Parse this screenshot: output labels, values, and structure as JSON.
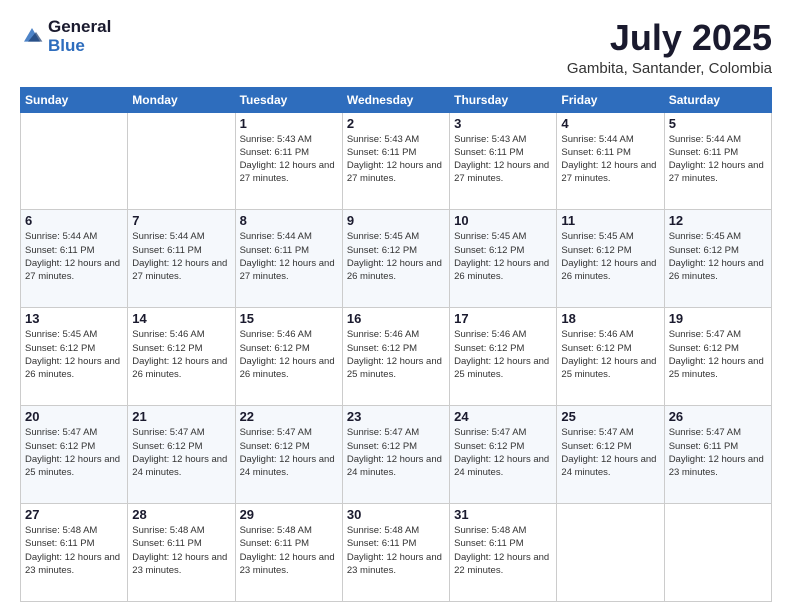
{
  "logo": {
    "general": "General",
    "blue": "Blue"
  },
  "header": {
    "month": "July 2025",
    "location": "Gambita, Santander, Colombia"
  },
  "weekdays": [
    "Sunday",
    "Monday",
    "Tuesday",
    "Wednesday",
    "Thursday",
    "Friday",
    "Saturday"
  ],
  "weeks": [
    [
      {
        "day": "",
        "info": ""
      },
      {
        "day": "",
        "info": ""
      },
      {
        "day": "1",
        "info": "Sunrise: 5:43 AM\nSunset: 6:11 PM\nDaylight: 12 hours and 27 minutes."
      },
      {
        "day": "2",
        "info": "Sunrise: 5:43 AM\nSunset: 6:11 PM\nDaylight: 12 hours and 27 minutes."
      },
      {
        "day": "3",
        "info": "Sunrise: 5:43 AM\nSunset: 6:11 PM\nDaylight: 12 hours and 27 minutes."
      },
      {
        "day": "4",
        "info": "Sunrise: 5:44 AM\nSunset: 6:11 PM\nDaylight: 12 hours and 27 minutes."
      },
      {
        "day": "5",
        "info": "Sunrise: 5:44 AM\nSunset: 6:11 PM\nDaylight: 12 hours and 27 minutes."
      }
    ],
    [
      {
        "day": "6",
        "info": "Sunrise: 5:44 AM\nSunset: 6:11 PM\nDaylight: 12 hours and 27 minutes."
      },
      {
        "day": "7",
        "info": "Sunrise: 5:44 AM\nSunset: 6:11 PM\nDaylight: 12 hours and 27 minutes."
      },
      {
        "day": "8",
        "info": "Sunrise: 5:44 AM\nSunset: 6:11 PM\nDaylight: 12 hours and 27 minutes."
      },
      {
        "day": "9",
        "info": "Sunrise: 5:45 AM\nSunset: 6:12 PM\nDaylight: 12 hours and 26 minutes."
      },
      {
        "day": "10",
        "info": "Sunrise: 5:45 AM\nSunset: 6:12 PM\nDaylight: 12 hours and 26 minutes."
      },
      {
        "day": "11",
        "info": "Sunrise: 5:45 AM\nSunset: 6:12 PM\nDaylight: 12 hours and 26 minutes."
      },
      {
        "day": "12",
        "info": "Sunrise: 5:45 AM\nSunset: 6:12 PM\nDaylight: 12 hours and 26 minutes."
      }
    ],
    [
      {
        "day": "13",
        "info": "Sunrise: 5:45 AM\nSunset: 6:12 PM\nDaylight: 12 hours and 26 minutes."
      },
      {
        "day": "14",
        "info": "Sunrise: 5:46 AM\nSunset: 6:12 PM\nDaylight: 12 hours and 26 minutes."
      },
      {
        "day": "15",
        "info": "Sunrise: 5:46 AM\nSunset: 6:12 PM\nDaylight: 12 hours and 26 minutes."
      },
      {
        "day": "16",
        "info": "Sunrise: 5:46 AM\nSunset: 6:12 PM\nDaylight: 12 hours and 25 minutes."
      },
      {
        "day": "17",
        "info": "Sunrise: 5:46 AM\nSunset: 6:12 PM\nDaylight: 12 hours and 25 minutes."
      },
      {
        "day": "18",
        "info": "Sunrise: 5:46 AM\nSunset: 6:12 PM\nDaylight: 12 hours and 25 minutes."
      },
      {
        "day": "19",
        "info": "Sunrise: 5:47 AM\nSunset: 6:12 PM\nDaylight: 12 hours and 25 minutes."
      }
    ],
    [
      {
        "day": "20",
        "info": "Sunrise: 5:47 AM\nSunset: 6:12 PM\nDaylight: 12 hours and 25 minutes."
      },
      {
        "day": "21",
        "info": "Sunrise: 5:47 AM\nSunset: 6:12 PM\nDaylight: 12 hours and 24 minutes."
      },
      {
        "day": "22",
        "info": "Sunrise: 5:47 AM\nSunset: 6:12 PM\nDaylight: 12 hours and 24 minutes."
      },
      {
        "day": "23",
        "info": "Sunrise: 5:47 AM\nSunset: 6:12 PM\nDaylight: 12 hours and 24 minutes."
      },
      {
        "day": "24",
        "info": "Sunrise: 5:47 AM\nSunset: 6:12 PM\nDaylight: 12 hours and 24 minutes."
      },
      {
        "day": "25",
        "info": "Sunrise: 5:47 AM\nSunset: 6:12 PM\nDaylight: 12 hours and 24 minutes."
      },
      {
        "day": "26",
        "info": "Sunrise: 5:47 AM\nSunset: 6:11 PM\nDaylight: 12 hours and 23 minutes."
      }
    ],
    [
      {
        "day": "27",
        "info": "Sunrise: 5:48 AM\nSunset: 6:11 PM\nDaylight: 12 hours and 23 minutes."
      },
      {
        "day": "28",
        "info": "Sunrise: 5:48 AM\nSunset: 6:11 PM\nDaylight: 12 hours and 23 minutes."
      },
      {
        "day": "29",
        "info": "Sunrise: 5:48 AM\nSunset: 6:11 PM\nDaylight: 12 hours and 23 minutes."
      },
      {
        "day": "30",
        "info": "Sunrise: 5:48 AM\nSunset: 6:11 PM\nDaylight: 12 hours and 23 minutes."
      },
      {
        "day": "31",
        "info": "Sunrise: 5:48 AM\nSunset: 6:11 PM\nDaylight: 12 hours and 22 minutes."
      },
      {
        "day": "",
        "info": ""
      },
      {
        "day": "",
        "info": ""
      }
    ]
  ]
}
